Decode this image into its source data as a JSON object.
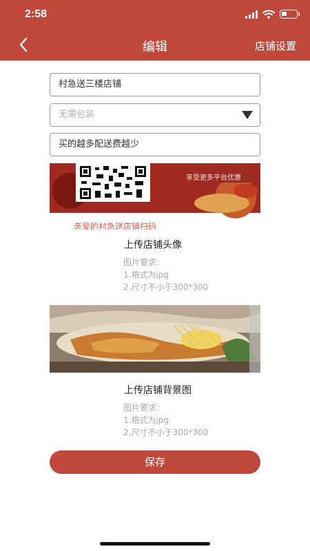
{
  "status_bar": {
    "time": "2:58",
    "signal_icon": "signal-icon",
    "wifi_icon": "wifi-icon",
    "battery_icon": "battery-icon"
  },
  "nav": {
    "back_icon": "chevron-left-icon",
    "title": "编辑",
    "right_label": "店铺设置"
  },
  "form": {
    "shop_name": "村急送三楼店铺",
    "packaging_select": "无需包装",
    "promo_text": "买的越多配送费越少"
  },
  "avatar_upload": {
    "image_text_1": "享受更多平台优惠",
    "image_text_2": "亲爱的村急送店铺扫码",
    "title": "上传店铺头像",
    "requirements": [
      "图片要求:",
      "1.格式为jpg",
      "2.尺寸不小于300*300"
    ]
  },
  "background_upload": {
    "title": "上传店铺背景图",
    "requirements": [
      "图片要求:",
      "1.格式为jpg",
      "2.尺寸不小于300*300"
    ]
  },
  "save_label": "保存",
  "colors": {
    "brand": "#c0483b",
    "border": "#9a9a9a",
    "hint": "#aaaaaa"
  }
}
